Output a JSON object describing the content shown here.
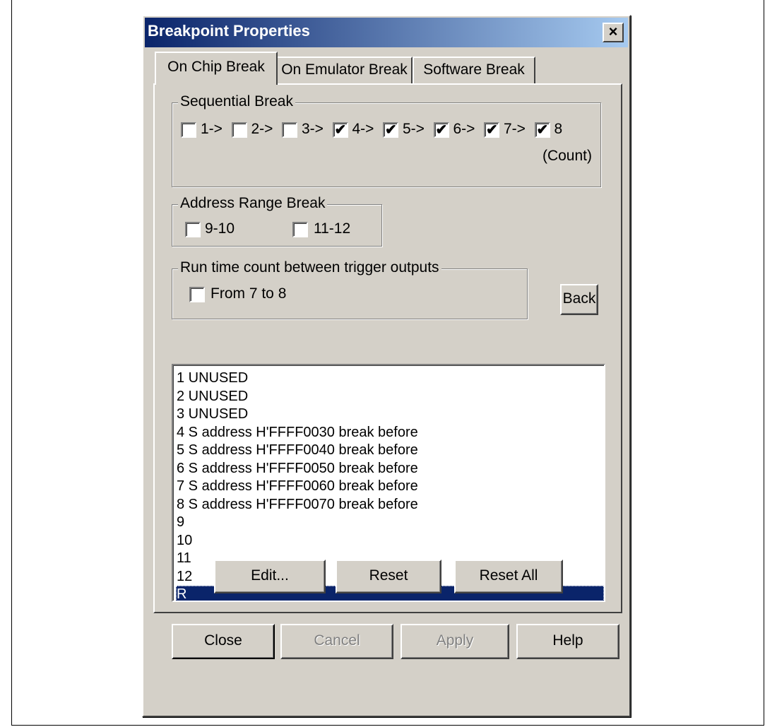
{
  "dialog": {
    "title": "Breakpoint Properties",
    "close_glyph": "×"
  },
  "tabs": [
    {
      "label": "On Chip Break",
      "active": true
    },
    {
      "label": "On Emulator Break",
      "active": false
    },
    {
      "label": "Software Break",
      "active": false
    }
  ],
  "sequential": {
    "legend": "Sequential Break",
    "items": [
      {
        "label": "1->",
        "checked": false
      },
      {
        "label": "2->",
        "checked": false
      },
      {
        "label": "3->",
        "checked": false
      },
      {
        "label": "4->",
        "checked": true
      },
      {
        "label": "5->",
        "checked": true
      },
      {
        "label": "6->",
        "checked": true
      },
      {
        "label": "7->",
        "checked": true
      },
      {
        "label": "8",
        "checked": true
      }
    ],
    "count_label": "(Count)"
  },
  "address_range": {
    "legend": "Address Range Break",
    "items": [
      {
        "label": "9-10",
        "checked": false
      },
      {
        "label": "11-12",
        "checked": false
      }
    ]
  },
  "runtime": {
    "legend": "Run time count between trigger outputs",
    "item": {
      "label": "From 7 to 8",
      "checked": false
    },
    "back_button": "Back"
  },
  "list": [
    "1 UNUSED",
    "2 UNUSED",
    "3 UNUSED",
    "4 S address H'FFFF0030 break before",
    "5 S address H'FFFF0040 break before",
    "6 S address H'FFFF0050 break before",
    "7 S address H'FFFF0060 break before",
    "8 S address H'FFFF0070 break before",
    "9",
    "10",
    "11",
    "12",
    "R"
  ],
  "selected_index": 12,
  "panel_buttons": {
    "edit": "Edit...",
    "reset": "Reset",
    "reset_all": "Reset All"
  },
  "footer_buttons": {
    "close": "Close",
    "cancel": "Cancel",
    "apply": "Apply",
    "help": "Help"
  },
  "colors": {
    "titlebar_start": "#0a246a",
    "titlebar_end": "#a6caf0",
    "selection": "#0a246a",
    "face": "#d4d0c8"
  }
}
